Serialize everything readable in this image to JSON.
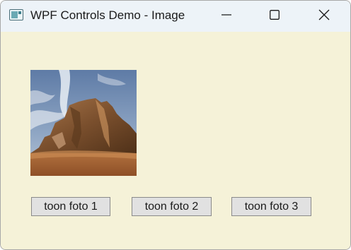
{
  "window": {
    "title": "WPF Controls Demo - Image",
    "icon": "app-window-icon",
    "caption_buttons": [
      "minimize-icon",
      "maximize-icon",
      "close-icon"
    ]
  },
  "image": {
    "description_icon": "desert-rock-photo"
  },
  "buttons": [
    {
      "label": "toon foto 1"
    },
    {
      "label": "toon foto 2"
    },
    {
      "label": "toon foto 3"
    }
  ],
  "colors": {
    "client_background": "#f5f2d8",
    "titlebar_background": "#edf3f8",
    "button_face": "#e1e1e1",
    "button_border": "#8a8a8a"
  }
}
